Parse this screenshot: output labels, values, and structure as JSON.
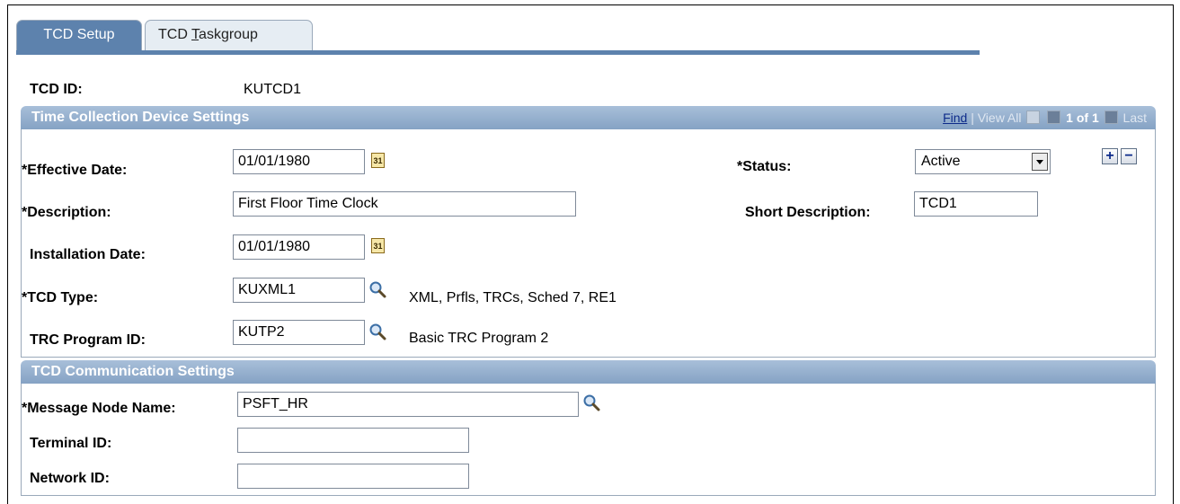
{
  "tabs": [
    {
      "label": "TCD Setup"
    },
    {
      "label_prefix": "TCD ",
      "label_accel": "T",
      "label_suffix": "askgroup"
    }
  ],
  "tcd_id": {
    "label": "TCD ID:",
    "value": "KUTCD1"
  },
  "device_settings": {
    "title": "Time Collection Device Settings",
    "nav": {
      "find": "Find",
      "separator": "|",
      "view_all": "View All",
      "count": "1 of 1",
      "last": "Last"
    },
    "effective_date": {
      "label": "*Effective Date:",
      "value": "01/01/1980"
    },
    "status": {
      "label": "*Status:",
      "value": "Active"
    },
    "description": {
      "label": "*Description:",
      "value": "First Floor Time Clock"
    },
    "short_description": {
      "label": "Short Description:",
      "value": "TCD1"
    },
    "installation_date": {
      "label": "Installation Date:",
      "value": "01/01/1980"
    },
    "tcd_type": {
      "label": "*TCD Type:",
      "value": "KUXML1",
      "description": "XML, Prfls, TRCs, Sched 7, RE1"
    },
    "trc_program_id": {
      "label": "TRC Program ID:",
      "value": "KUTP2",
      "description": "Basic TRC Program 2"
    },
    "calendar_glyph": "31"
  },
  "communication_settings": {
    "title": "TCD Communication Settings",
    "message_node_name": {
      "label": "*Message Node Name:",
      "value": "PSFT_HR"
    },
    "terminal_id": {
      "label": "Terminal ID:",
      "value": ""
    },
    "network_id": {
      "label": "Network ID:",
      "value": ""
    }
  },
  "colors": {
    "tab_active": "#5d82ad",
    "section_header": "#85a2c4",
    "link": "#0d2b8a"
  }
}
